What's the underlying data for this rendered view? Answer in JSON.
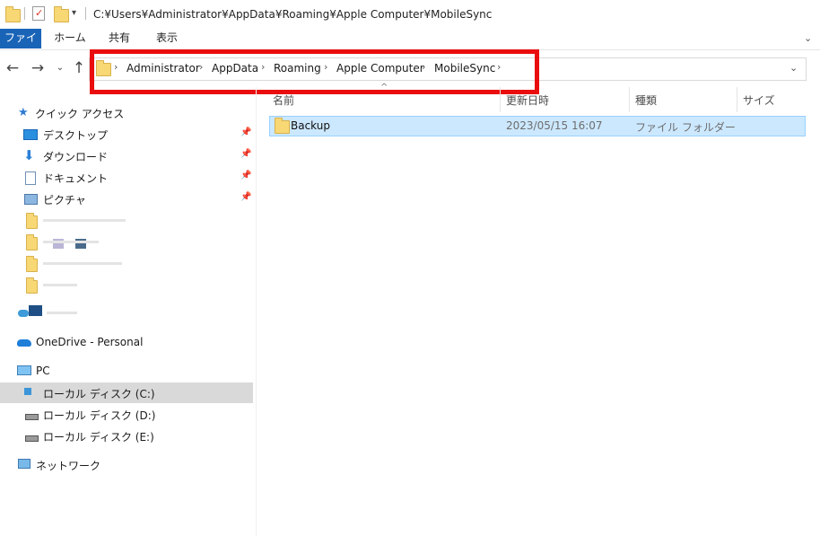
{
  "window": {
    "title_path": "C:¥Users¥Administrator¥AppData¥Roaming¥Apple Computer¥MobileSync"
  },
  "ribbon": {
    "tabs": [
      "ファイル",
      "ホーム",
      "共有",
      "表示"
    ]
  },
  "address": {
    "breadcrumbs": [
      "Administrator",
      "AppData",
      "Roaming",
      "Apple Computer",
      "MobileSync"
    ],
    "separator": "›"
  },
  "colors": {
    "highlight": "#ea0d0d",
    "accent": "#1a64b8",
    "selection": "#cce8ff"
  },
  "sidebar": {
    "quick_access": "クイック アクセス",
    "pinned": [
      "デスクトップ",
      "ダウンロード",
      "ドキュメント",
      "ピクチャ"
    ],
    "onedrive": "OneDrive - Personal",
    "pc": "PC",
    "drives": [
      "ローカル ディスク (C:)",
      "ローカル ディスク (D:)",
      "ローカル ディスク (E:)"
    ],
    "network": "ネットワーク"
  },
  "columns": [
    "名前",
    "更新日時",
    "種類",
    "サイズ"
  ],
  "files": [
    {
      "name": "Backup",
      "modified": "2023/05/15 16:07",
      "type": "ファイル フォルダー",
      "size": ""
    }
  ],
  "icons": [
    "folder-icon",
    "checklist-icon",
    "dropdown-arrow-icon",
    "back-arrow-icon",
    "forward-arrow-icon",
    "recent-dropdown-icon",
    "up-arrow-icon",
    "star-icon",
    "desktop-icon",
    "download-icon",
    "document-icon",
    "picture-icon",
    "pin-icon",
    "onedrive-icon",
    "pc-icon",
    "drive-icon",
    "network-icon",
    "address-dropdown-icon"
  ]
}
